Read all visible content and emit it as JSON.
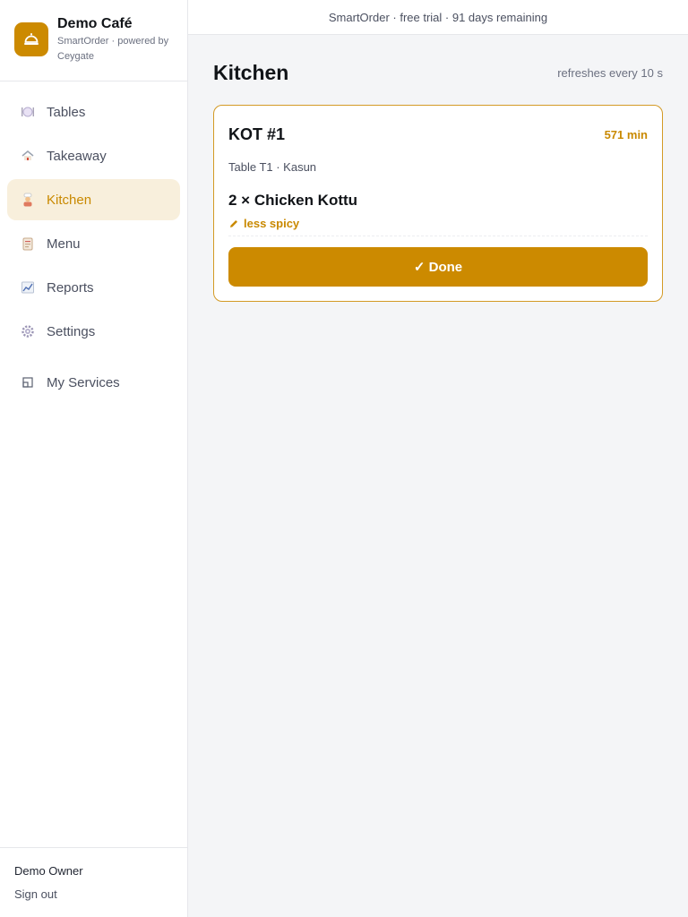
{
  "brand": {
    "name": "Demo Café",
    "subtitle": "SmartOrder · powered by Ceygate",
    "logo_icon": "cloche-icon",
    "accent_color": "#cc8a00"
  },
  "topbar": {
    "text": "SmartOrder · free trial · 91 days remaining"
  },
  "nav": {
    "items": [
      {
        "label": "Tables",
        "icon": "plate-cutlery-icon"
      },
      {
        "label": "Takeaway",
        "icon": "house-icon"
      },
      {
        "label": "Kitchen",
        "icon": "cook-icon",
        "active": true
      },
      {
        "label": "Menu",
        "icon": "clipboard-icon"
      },
      {
        "label": "Reports",
        "icon": "chart-icon"
      },
      {
        "label": "Settings",
        "icon": "gear-icon"
      },
      {
        "label": "My Services",
        "icon": "window-icon"
      }
    ]
  },
  "footer": {
    "owner": "Demo Owner",
    "sign_out": "Sign out"
  },
  "page": {
    "title": "Kitchen",
    "refresh_note": "refreshes every 10 s"
  },
  "kot": {
    "title": "KOT #1",
    "elapsed": "571 min",
    "meta": "Table T1 · Kasun",
    "item": "2 × Chicken Kottu",
    "note": "less spicy",
    "done_label": "✓ Done"
  }
}
